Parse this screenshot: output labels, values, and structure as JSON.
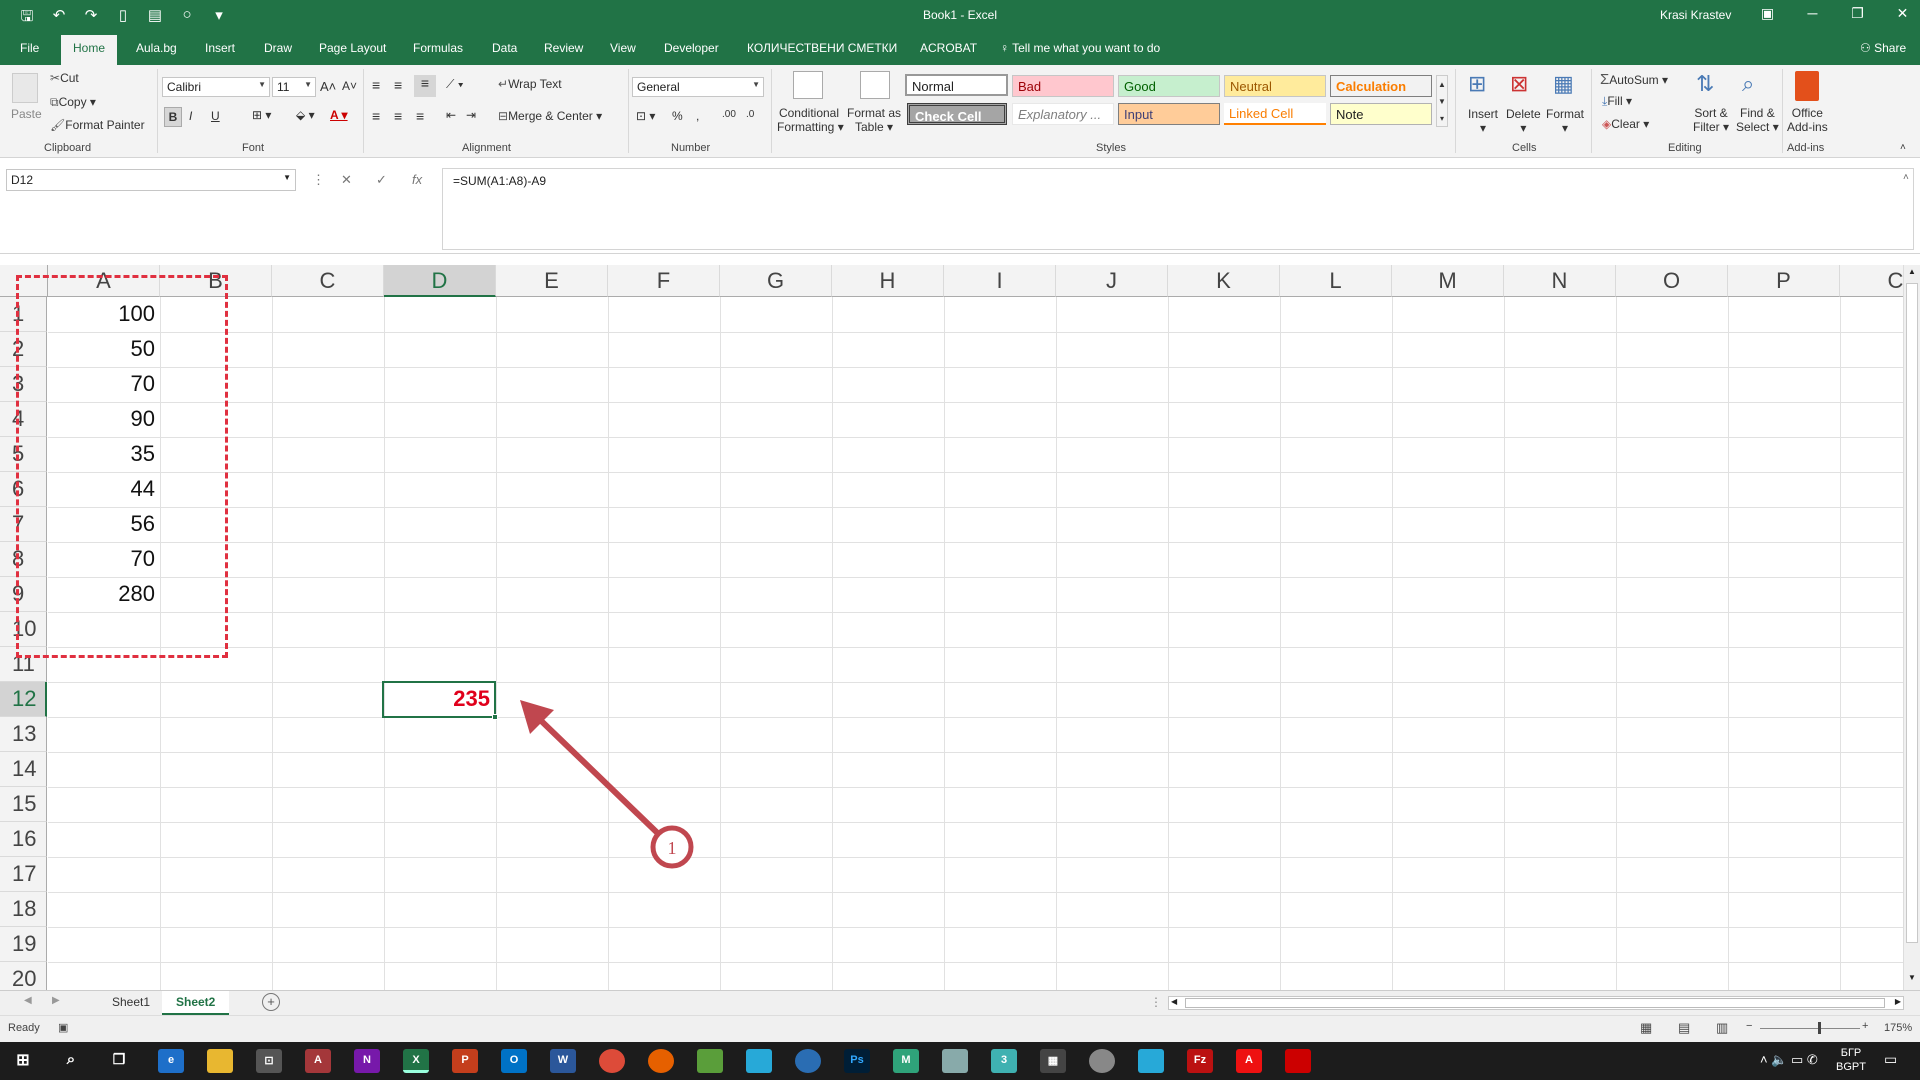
{
  "app": {
    "title": "Book1  -  Excel",
    "user": "Krasi Krastev"
  },
  "tabs": {
    "file": "File",
    "home": "Home",
    "aula": "Aula.bg",
    "insert": "Insert",
    "draw": "Draw",
    "page_layout": "Page Layout",
    "formulas": "Formulas",
    "data": "Data",
    "review": "Review",
    "view": "View",
    "developer": "Developer",
    "kol": "КОЛИЧЕСТВЕНИ СМЕТКИ",
    "acrobat": "ACROBAT",
    "tell": "Tell me what you want to do",
    "share": "Share"
  },
  "ribbon": {
    "clipboard": {
      "paste": "Paste",
      "cut": "Cut",
      "copy": "Copy",
      "format_painter": "Format Painter",
      "label": "Clipboard"
    },
    "font": {
      "name": "Calibri",
      "size": "11",
      "bold": "B",
      "italic": "I",
      "underline": "U",
      "label": "Font"
    },
    "alignment": {
      "wrap": "Wrap Text",
      "merge": "Merge & Center",
      "label": "Alignment"
    },
    "number": {
      "format": "General",
      "label": "Number"
    },
    "styles": {
      "cond_fmt_1": "Conditional",
      "cond_fmt_2": "Formatting",
      "fmt_table_1": "Format as",
      "fmt_table_2": "Table",
      "normal": "Normal",
      "bad": "Bad",
      "good": "Good",
      "neutral": "Neutral",
      "calculation": "Calculation",
      "check_cell": "Check Cell",
      "explanatory": "Explanatory ...",
      "input": "Input",
      "linked_cell": "Linked Cell",
      "note": "Note",
      "label": "Styles"
    },
    "cells": {
      "insert": "Insert",
      "delete": "Delete",
      "format": "Format",
      "label": "Cells"
    },
    "editing": {
      "autosum": "AutoSum",
      "fill": "Fill",
      "clear": "Clear",
      "sort_1": "Sort &",
      "sort_2": "Filter",
      "find_1": "Find &",
      "find_2": "Select",
      "label": "Editing"
    },
    "addins": {
      "office_1": "Office",
      "office_2": "Add-ins",
      "label": "Add-ins"
    }
  },
  "formula_bar": {
    "name_box": "D12",
    "formula": "=SUM(A1:A8)-A9",
    "fx": "fx"
  },
  "columns": [
    "A",
    "B",
    "C",
    "D",
    "E",
    "F",
    "G",
    "H",
    "I",
    "J",
    "K",
    "L",
    "M",
    "N",
    "O",
    "P",
    "C"
  ],
  "rows": [
    "1",
    "2",
    "3",
    "4",
    "5",
    "6",
    "7",
    "8",
    "9",
    "10",
    "11",
    "12",
    "13",
    "14",
    "15",
    "16",
    "17",
    "18",
    "19",
    "20"
  ],
  "cells_a": [
    "100",
    "50",
    "70",
    "90",
    "35",
    "44",
    "56",
    "70",
    "280"
  ],
  "result_d12": "235",
  "callout_number": "1",
  "sheets": {
    "sheet1": "Sheet1",
    "sheet2": "Sheet2"
  },
  "status": {
    "ready": "Ready",
    "zoom": "175%"
  },
  "taskbar": {
    "lang": "БГР",
    "layout": "BGPT"
  },
  "colors": {
    "excel_green": "#217346",
    "marquee_red": "#e03040",
    "result_red": "#e0001b",
    "arrow": "#c0474f"
  }
}
